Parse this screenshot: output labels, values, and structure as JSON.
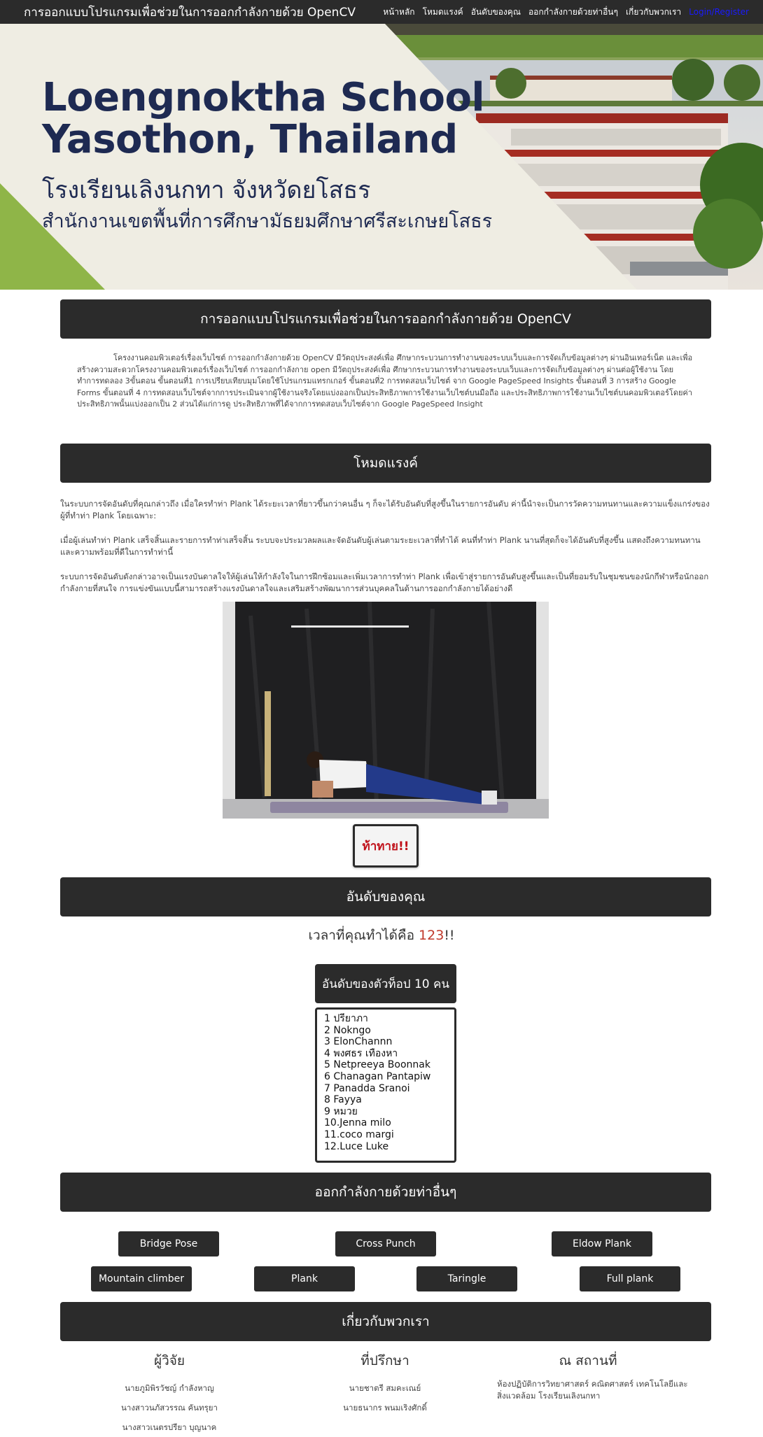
{
  "nav": {
    "brand": "การออกแบบโปรแกรมเพื่อช่วยในการออกกำลังกายด้วย OpenCV",
    "links": [
      "หน้าหลัก",
      "โหมดแรงค์",
      "อันดับของคุณ",
      "ออกกำลังกายด้วยท่าอื่นๆ",
      "เกี่ยวกับพวกเรา",
      "Login/Register"
    ]
  },
  "hero": {
    "title_line1": "Loengnoktha School",
    "title_line2": "Yasothon, Thailand",
    "thai_line1": "โรงเรียนเลิงนกทา จังหวัดยโสธร",
    "thai_line2": "สำนักงานเขตพื้นที่การศึกษามัธยมศึกษาศรีสะเกษยโสธร"
  },
  "intro": {
    "heading": "การออกแบบโปรแกรมเพื่อช่วยในการออกกำลังกายด้วย OpenCV",
    "text": "โครงงานคอมพิวเตอร์เรื่องเว็บไซต์ การออกกำลังกายด้วย OpenCV มีวัตถุประสงค์เพื่อ ศึกษากระบวนการทำงานของระบบเว็บและการจัดเก็บข้อมูลต่างๆ ผ่านอินเทอร์เน็ต และเพื่อสร้างความสะดวกโครงงานคอมพิวเตอร์เรื่องเว็บไซต์ การออกกำลังกาย open มีวัตถุประสงค์เพื่อ ศึกษากระบวนการทำงานของระบบเว็บและการจัดเก็บข้อมูลต่างๆ ผ่านต่อผู้ใช้งาน โดยทำการทดลอง 3ขั้นตอน ขั้นตอนที่1 การเปรียบเทียบมุมโดยใช้โปรแกรมแทรกเกอร์ ขั้นตอนที่2 การทดสอบเว็บไซต์ จาก Google PageSpeed Insights ขั้นตอนที่ 3 การสร้าง Google Forms ขั้นตอนที่ 4 การทดสอบเว็บไซต์จากการประเมินจากผู้ใช้งานจริงโดยแบ่งออกเป็นประสิทธิภาพการใช้งานเว็บไซต์บนมือถือ และประสิทธิภาพการใช้งานเว็บไซต์บนคอมพิวเตอร์โดยค่าประสิทธิภาพนั้นแบ่งออกเป็น 2 ส่วนได้แก่การดู ประสิทธิภาพที่ได้จากการทดสอบเว็บไซต์จาก Google PageSpeed Insight"
  },
  "rank": {
    "heading": "โหมดแรงค์",
    "p1": "ในระบบการจัดอันดับที่คุณกล่าวถึง เมื่อใครทำท่า Plank ได้ระยะเวลาที่ยาวขึ้นกว่าคนอื่น ๆ ก็จะได้รับอันดับที่สูงขึ้นในรายการอันดับ ค่านี้นำจะเป็นการวัดความทนทานและความแข็งแกร่งของผู้ที่ทำท่า Plank โดยเฉพาะ:",
    "p2": "เมื่อผู้เล่นทำท่า Plank เสร็จสิ้นและรายการทำท่าเสร็จสิ้น ระบบจะประมวลผลและจัดอันดับผู้เล่นตามระยะเวลาที่ทำได้ คนที่ทำท่า Plank นานที่สุดก็จะได้อันดับที่สูงขึ้น แสดงถึงความทนทานและความพร้อมที่ดีในการทำท่านี้",
    "p3": "ระบบการจัดอันดับดังกล่าวอาจเป็นแรงบันดาลใจให้ผู้เล่นให้กำลังใจในการฝึกซ้อมและเพิ่มเวลาการทำท่า Plank เพื่อเข้าสู่รายการอันดับสูงขึ้นและเป็นที่ยอมรับในชุมชนของนักกีฬาหรือนักออกกำลังกายที่สนใจ การแข่งขันแบบนี้สามารถสร้างแรงบันดาลใจและเสริมสร้างพัฒนาการส่วนบุคคลในด้านการออกกำลังกายได้อย่างดี",
    "challenge_label": "ท้าทาย!!"
  },
  "yourrank": {
    "heading": "อันดับของคุณ",
    "time_prefix": "เวลาที่คุณทำได้คือ",
    "time_value": "123",
    "time_suffix": "!!",
    "top10_heading": "อันดับของตัวท็อป 10 คน",
    "top10": [
      "1 ปรียาภา",
      "2 Nokngo",
      "3 ElonChannn",
      "4 พงศธร เทืองหา",
      "5 Netpreeya Boonnak",
      "6 Chanagan Pantapiw",
      "7 Panadda Sranoi",
      "8 Fayya",
      "9 หมวย",
      "10.Jenna milo",
      "11.coco margi",
      "12.Luce Luke"
    ]
  },
  "exercises": {
    "heading": "ออกกำลังกายด้วยท่าอื่นๆ",
    "row1": [
      "Bridge Pose",
      "Cross Punch",
      "Eldow Plank"
    ],
    "row2": [
      "Mountain climber",
      "Plank",
      "Taringle",
      "Full plank"
    ]
  },
  "about": {
    "heading": "เกี่ยวกับพวกเรา",
    "researchers_title": "ผู้วิจัย",
    "researchers": [
      "นายภูมิพิรวัชญ์ กำลังหาญ",
      "นางสาวนภัสวรรณ คันทรุยา",
      "นางสาวเนตรปรียา บุญนาค"
    ],
    "advisors_title": "ที่ปรึกษา",
    "advisors": [
      "นายชาตรี สมคะเณย์",
      "นายธนากร พนมเริงศักดิ์"
    ],
    "location_title": "ณ สถานที่",
    "location": "ห้องปฏิบัติการวิทยาศาสตร์ คณิตศาสตร์ เทคโนโลยีและสิ่งแวดล้อม โรงเรียนเลิงนกทา"
  }
}
